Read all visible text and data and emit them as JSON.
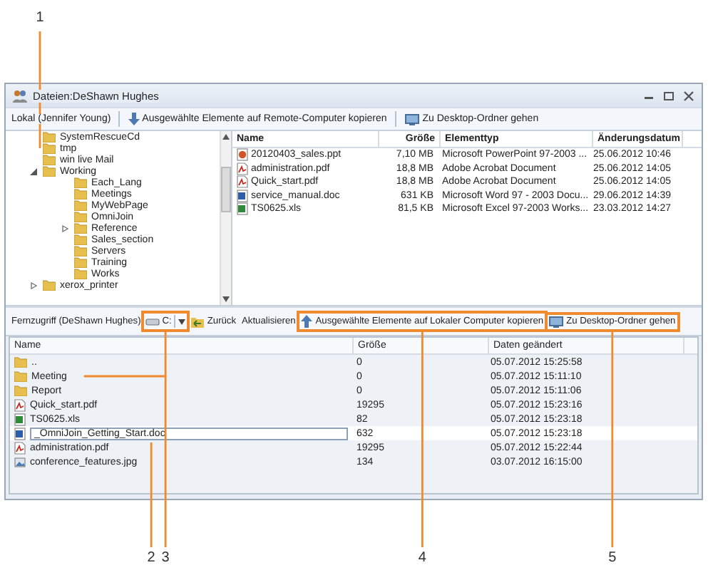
{
  "window": {
    "title": "Dateien:DeShawn Hughes"
  },
  "local_toolbar": {
    "label": "Lokal (Jennifer Young)",
    "copy_button": "Ausgewählte Elemente auf Remote-Computer kopieren",
    "desktop_button": "Zu Desktop-Ordner gehen"
  },
  "local_tree": [
    {
      "label": "SystemRescueCd"
    },
    {
      "label": "tmp"
    },
    {
      "label": "win live Mail"
    },
    {
      "label": "Working",
      "expanded": true,
      "children": [
        {
          "label": "Each_Lang"
        },
        {
          "label": "Meetings"
        },
        {
          "label": "MyWebPage"
        },
        {
          "label": "OmniJoin"
        },
        {
          "label": "Reference",
          "expanded": false
        },
        {
          "label": "Sales_section"
        },
        {
          "label": "Servers"
        },
        {
          "label": "Training"
        },
        {
          "label": "Works"
        }
      ]
    },
    {
      "label": "xerox_printer",
      "expanded": false
    }
  ],
  "local_files": {
    "columns": [
      "Name",
      "Größe",
      "Elementtyp",
      "Änderungsdatum"
    ],
    "rows": [
      {
        "kind": "ppt",
        "name": "20120403_sales.ppt",
        "size": "7,10 MB",
        "type": "Microsoft PowerPoint 97-2003 ...",
        "date": "25.06.2012 10:46"
      },
      {
        "kind": "pdf",
        "name": "administration.pdf",
        "size": "18,8 MB",
        "type": "Adobe Acrobat Document",
        "date": "25.06.2012 14:05"
      },
      {
        "kind": "pdf",
        "name": "Quick_start.pdf",
        "size": "18,8 MB",
        "type": "Adobe Acrobat Document",
        "date": "25.06.2012 14:05"
      },
      {
        "kind": "doc",
        "name": "service_manual.doc",
        "size": "631 KB",
        "type": "Microsoft Word 97 - 2003 Docu...",
        "date": "29.06.2012 14:39"
      },
      {
        "kind": "xls",
        "name": "TS0625.xls",
        "size": "81,5 KB",
        "type": "Microsoft Excel 97-2003 Works...",
        "date": "23.03.2012 14:27"
      }
    ]
  },
  "remote_toolbar": {
    "label": "Fernzugriff (DeShawn Hughes)",
    "drive": {
      "label": "C:",
      "highlighted": true
    },
    "back_button": "Zurück",
    "refresh_button": "Aktualisieren",
    "copy_button": {
      "label": "Ausgewählte Elemente auf Lokaler Computer kopieren",
      "highlighted": true
    },
    "desktop_button": {
      "label": "Zu Desktop-Ordner gehen",
      "highlighted": true
    }
  },
  "remote_files": {
    "columns": [
      "Name",
      "Größe",
      "Daten geändert"
    ],
    "rows": [
      {
        "kind": "folder",
        "name": "..",
        "size": "0",
        "date": "05.07.2012 15:25:58",
        "selected": false
      },
      {
        "kind": "folder",
        "name": "Meeting",
        "size": "0",
        "date": "05.07.2012 15:11:10",
        "selected": false
      },
      {
        "kind": "folder",
        "name": "Report",
        "size": "0",
        "date": "05.07.2012 15:11:06",
        "selected": false
      },
      {
        "kind": "pdf",
        "name": "Quick_start.pdf",
        "size": "19295",
        "date": "05.07.2012 15:23:16",
        "selected": false
      },
      {
        "kind": "xls",
        "name": "TS0625.xls",
        "size": "82",
        "date": "05.07.2012 15:23:18",
        "selected": false
      },
      {
        "kind": "doc",
        "name": "_OmniJoin_Getting_Start.doc",
        "size": "632",
        "date": "05.07.2012 15:23:18",
        "selected": true
      },
      {
        "kind": "pdf",
        "name": "administration.pdf",
        "size": "19295",
        "date": "05.07.2012 15:22:44",
        "selected": false
      },
      {
        "kind": "image",
        "name": "conference_features.jpg",
        "size": "134",
        "date": "03.07.2012 16:15:00",
        "selected": false
      }
    ]
  },
  "callouts": [
    {
      "label": "1"
    },
    {
      "label": "2"
    },
    {
      "label": "3"
    },
    {
      "label": "4"
    },
    {
      "label": "5"
    }
  ]
}
